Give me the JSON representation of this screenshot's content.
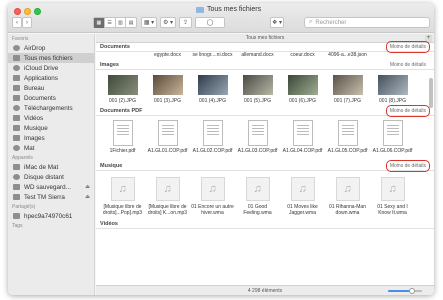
{
  "window": {
    "title": "Tous mes fichiers"
  },
  "toolbar": {
    "back": "‹",
    "forward": "›",
    "view_buttons": [
      "▦",
      "☰",
      "▥",
      "▤"
    ],
    "group_label": "▦ ▾",
    "action_label": "⚙ ▾",
    "share_label": "⇪",
    "tag_label": "◯",
    "dropbox_label": "❖ ▾",
    "search_placeholder": "Rechercher"
  },
  "sidebar": {
    "favorites_title": "Favoris",
    "favorites": [
      {
        "label": "AirDrop",
        "icon": "airdrop-icon"
      },
      {
        "label": "Tous mes fichiers",
        "icon": "all-files-icon",
        "active": true
      },
      {
        "label": "iCloud Drive",
        "icon": "cloud-icon"
      },
      {
        "label": "Applications",
        "icon": "applications-icon"
      },
      {
        "label": "Bureau",
        "icon": "desktop-icon"
      },
      {
        "label": "Documents",
        "icon": "documents-icon"
      },
      {
        "label": "Téléchargements",
        "icon": "downloads-icon"
      },
      {
        "label": "Vidéos",
        "icon": "videos-icon"
      },
      {
        "label": "Musique",
        "icon": "music-icon"
      },
      {
        "label": "Images",
        "icon": "images-icon"
      },
      {
        "label": "Mat",
        "icon": "home-icon"
      }
    ],
    "devices_title": "Appareils",
    "devices": [
      {
        "label": "iMac de Mat",
        "icon": "imac-icon"
      },
      {
        "label": "Disque distant",
        "icon": "remote-disk-icon"
      },
      {
        "label": "WD sauvegard...",
        "icon": "external-drive-icon",
        "eject": true
      },
      {
        "label": "Test TM Sierra",
        "icon": "external-drive-icon",
        "eject": true
      }
    ],
    "shared_title": "Partagé(s)",
    "shared": [
      {
        "label": "hpec9a74970c61",
        "icon": "printer-icon"
      }
    ],
    "tags_title": "Tags"
  },
  "path_bar": {
    "label": "Tous mes fichiers",
    "plus": "+"
  },
  "groups": {
    "documents": {
      "title": "Documents",
      "more": "Moins de détails",
      "files": [
        "",
        "egypte.docx",
        "se linogr....ni.docx",
        "allemand.docx",
        "coeur.docx",
        "4096-a...e38.json",
        ""
      ]
    },
    "images": {
      "title": "Images",
      "more": "Moins de détails",
      "files": [
        "001 (2).JPG",
        "001 (3).JPG",
        "001 (4).JPG",
        "001 (5).JPG",
        "001 (6).JPG",
        "001 (7).JPG",
        "001 (8).JPG"
      ]
    },
    "pdf": {
      "title": "Documents PDF",
      "more": "Moins de détails",
      "files": [
        "1Fichier.pdf",
        "A1.GL01.COP.pdf",
        "A1.GL02.COP.pdf",
        "A1.GL03.COP.pdf",
        "A1.GL04.COP.pdf",
        "A1.GL05.COP.pdf",
        "A1.GL06.COP.pdf"
      ]
    },
    "music": {
      "title": "Musique",
      "more": "Moins de détails",
      "files": [
        "[Musique libre de droits]...Pop].mp3",
        "[Musique libre de droits] K...on.mp3",
        "01 Encore un autre hiver.wma",
        "01 Good Feeling.wma",
        "01 Moves like Jagger.wma",
        "01 Rihanna-Man down.wma",
        "01 Sexy and I Know It.wma"
      ]
    },
    "videos": {
      "title": "Vidéos"
    }
  },
  "status": {
    "count": "4 298 éléments",
    "zoom_fraction": 0.7
  },
  "colors": {
    "highlight_circle": "#d9362b",
    "accent": "#4a8ee9"
  }
}
